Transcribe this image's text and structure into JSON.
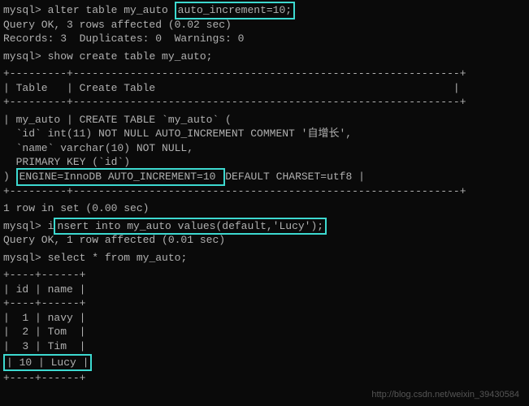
{
  "prompt": "mysql>",
  "cmd1": "alter table my_auto ",
  "cmd1_highlight": "auto_increment=10;",
  "result1_line1": "Query OK, 3 rows affected (0.02 sec)",
  "result1_line2": "Records: 3  Duplicates: 0  Warnings: 0",
  "cmd2": "show create table my_auto;",
  "table_border_top": "+---------+-------------------------------------------------------------+",
  "table_header": "| Table   | Create Table                                               |",
  "table_border_mid": "+---------+-------------------------------------------------------------+",
  "create_line1": "| my_auto | CREATE TABLE `my_auto` (",
  "create_line2": "  `id` int(11) NOT NULL AUTO_INCREMENT COMMENT '自增长',",
  "create_line3": "  `name` varchar(10) NOT NULL,",
  "create_line4": "  PRIMARY KEY (`id`)",
  "create_line5_pre": ") ",
  "create_line5_highlight": "ENGINE=InnoDB AUTO_INCREMENT=10 ",
  "create_line5_post": "DEFAULT CHARSET=utf8 |",
  "table_border_bot": "+---------+-------------------------------------------------------------+",
  "rows_in_set1": "1 row in set (0.00 sec)",
  "cmd3_pre": "i",
  "cmd3_highlight": "nsert into my_auto values(default,'Lucy');",
  "result3": "Query OK, 1 row affected (0.01 sec)",
  "cmd4": "select * from my_auto;",
  "select_border": "+----+------+",
  "select_header": "| id | name |",
  "select_row1": "|  1 | navy |",
  "select_row2": "|  2 | Tom  |",
  "select_row3": "|  3 | Tim  |",
  "select_row4": "| 10 | Lucy |",
  "watermark": "http://blog.csdn.net/weixin_39430584"
}
